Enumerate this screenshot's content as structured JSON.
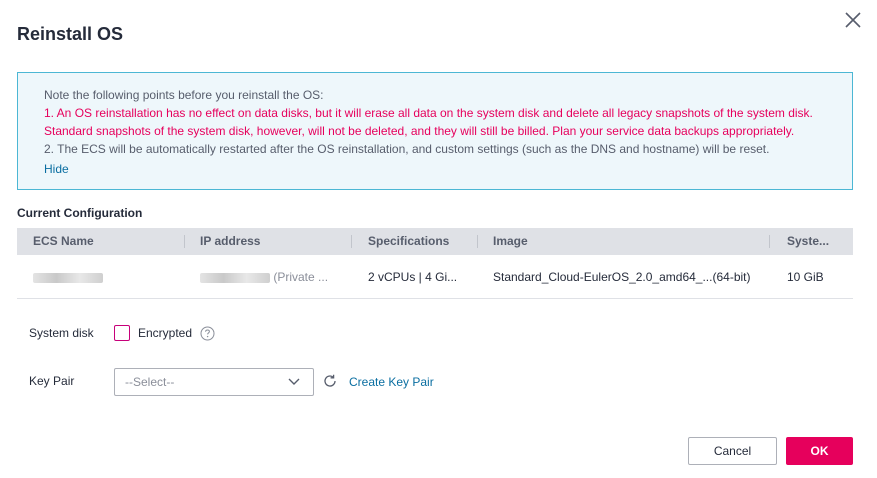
{
  "dialog": {
    "title": "Reinstall OS"
  },
  "notice": {
    "intro": "Note the following points before you reinstall the OS:",
    "point1_line1": "1. An OS reinstallation has no effect on data disks, but it will erase all data on the system disk and delete all legacy snapshots of the system disk.",
    "point1_line2": "Standard snapshots of the system disk, however, will not be deleted, and they will still be billed. Plan your service data backups appropriately.",
    "point2": "2. The ECS will be automatically restarted after the OS reinstallation, and custom settings (such as the DNS and hostname) will be reset.",
    "hide_label": "Hide",
    "colors": {
      "border": "#4cb7d4",
      "background": "#eef7fb",
      "warning_text": "#e6005c"
    }
  },
  "current_config": {
    "title": "Current Configuration",
    "columns": [
      "ECS Name",
      "IP address",
      "Specifications",
      "Image",
      "Syste..."
    ],
    "row": {
      "ecs_name": "",
      "ip_suffix": "(Private ...",
      "specifications": "2 vCPUs | 4 Gi...",
      "image": "Standard_Cloud-EulerOS_2.0_amd64_...(64-bit)",
      "system_disk": "10 GiB"
    }
  },
  "form": {
    "system_disk_label": "System disk",
    "encrypted_label": "Encrypted",
    "encrypted_checked": false,
    "key_pair_label": "Key Pair",
    "key_pair_placeholder": "--Select--",
    "create_key_pair_label": "Create Key Pair"
  },
  "footer": {
    "cancel_label": "Cancel",
    "ok_label": "OK",
    "accent_color": "#e6005c"
  },
  "icons": {
    "close": "close-icon",
    "help": "help-circle-icon",
    "chevron": "chevron-down-icon",
    "refresh": "refresh-icon"
  }
}
